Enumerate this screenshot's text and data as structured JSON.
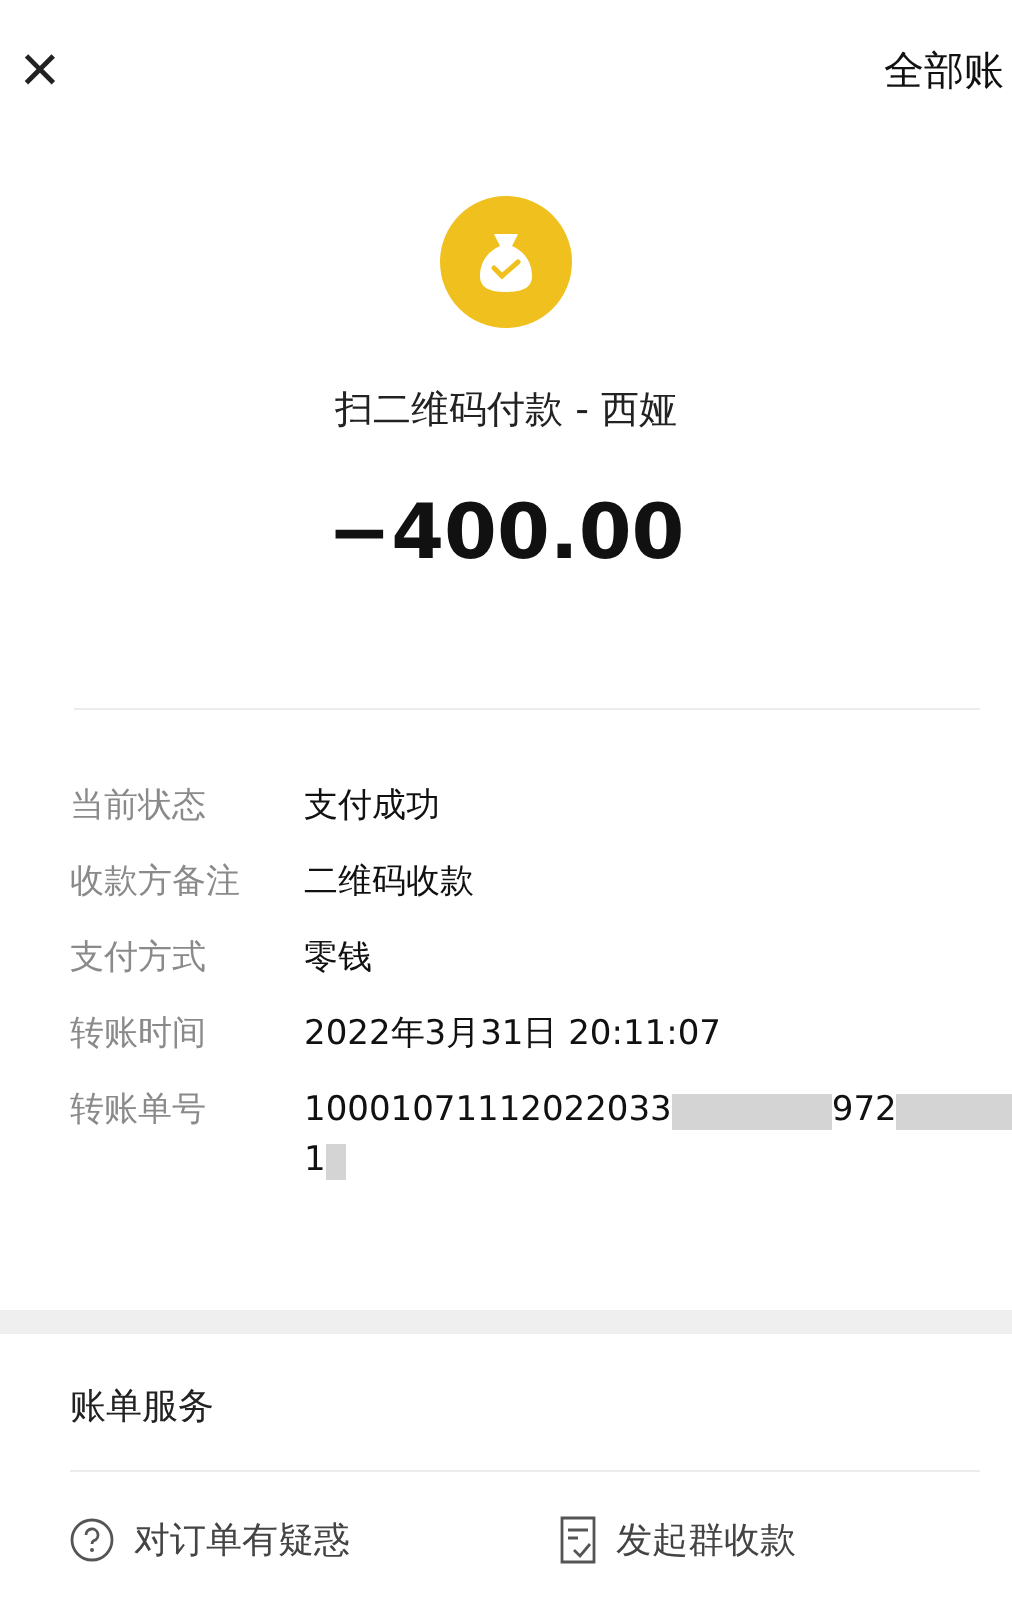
{
  "header": {
    "close": "×",
    "link": "全部账"
  },
  "merchant": {
    "title": "扫二维码付款 - 西娅",
    "amount": "−400.00"
  },
  "details": [
    {
      "label": "当前状态",
      "value_parts": [
        "支付成功"
      ]
    },
    {
      "label": "收款方备注",
      "value_parts": [
        "二维码收款"
      ]
    },
    {
      "label": "支付方式",
      "value_parts": [
        "零钱"
      ]
    },
    {
      "label": "转账时间",
      "value_parts": [
        "2022年3月31日 20:11:07"
      ]
    },
    {
      "label": "转账单号",
      "value_parts": [
        "10001071112022033",
        "972"
      ],
      "redacted": true,
      "second_line": "1"
    }
  ],
  "services": {
    "title": "账单服务",
    "actions": [
      {
        "kind": "question",
        "label": "对订单有疑惑"
      },
      {
        "kind": "document",
        "label": "发起群收款"
      }
    ]
  }
}
